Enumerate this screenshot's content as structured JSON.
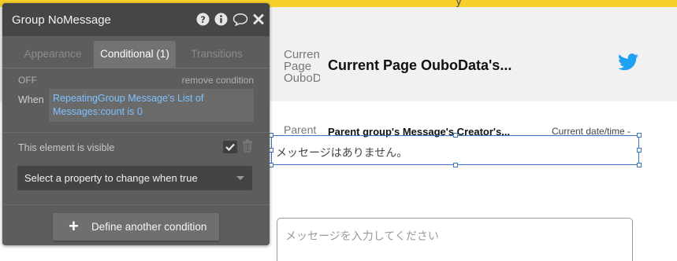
{
  "canvas": {
    "top_strip_char": "y",
    "page_image_alt": "Current Page OuboData's",
    "page_title": "Current Page OuboData's...",
    "message_image_alt": "Parent",
    "message_creator": "Parent group's Message's Creator's...",
    "message_datetime": "Current date/time -",
    "no_message_text": "メッセージはありません。",
    "input_placeholder": "メッセージを入力してください",
    "icons": {
      "twitter": "twitter-icon"
    },
    "colors": {
      "top_strip": "#f7cf2a",
      "selection": "#3a74c4",
      "twitter": "#1da1f2"
    }
  },
  "panel": {
    "title": "Group NoMessage",
    "header_icons": [
      "help-icon",
      "info-icon",
      "comment-icon",
      "close-icon"
    ],
    "tabs": [
      {
        "label": "Appearance",
        "active": false
      },
      {
        "label": "Conditional (1)",
        "active": true
      },
      {
        "label": "Transitions",
        "active": false
      }
    ],
    "condition": {
      "state": "OFF",
      "remove_label": "remove condition",
      "when_label": "When",
      "expression": "RepeatingGroup Message's List of Messages:count is 0"
    },
    "visible_label": "This element is visible",
    "visible_checked": true,
    "select_property_label": "Select a property to change when true",
    "define_button_label": "Define another condition",
    "colors": {
      "link_blue": "#7ec1ff",
      "panel_bg": "#5d5d5d",
      "header_bg": "#464646"
    }
  }
}
